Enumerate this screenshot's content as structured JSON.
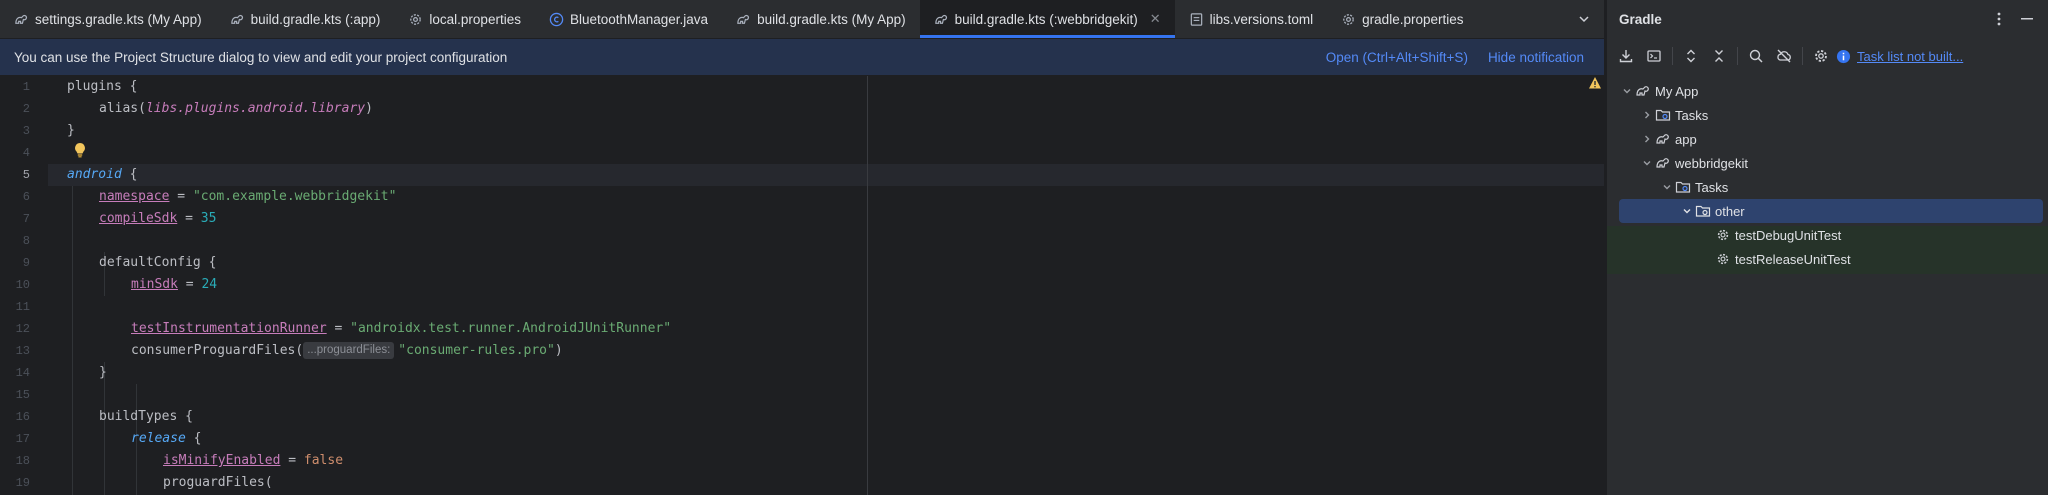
{
  "tabs": [
    {
      "label": "settings.gradle.kts (My App)",
      "icon": "gradle-icon",
      "active": false
    },
    {
      "label": "build.gradle.kts (:app)",
      "icon": "gradle-icon",
      "active": false
    },
    {
      "label": "local.properties",
      "icon": "settings-file-icon",
      "active": false
    },
    {
      "label": "BluetoothManager.java",
      "icon": "java-class-icon",
      "active": false
    },
    {
      "label": "build.gradle.kts (My App)",
      "icon": "gradle-icon",
      "active": false
    },
    {
      "label": "build.gradle.kts (:webbridgekit)",
      "icon": "gradle-icon",
      "active": true
    },
    {
      "label": "libs.versions.toml",
      "icon": "toml-icon",
      "active": false
    },
    {
      "label": "gradle.properties",
      "icon": "settings-file-icon",
      "active": false
    }
  ],
  "notification": {
    "text": "You can use the Project Structure dialog to view and edit your project configuration",
    "open_link": "Open (Ctrl+Alt+Shift+S)",
    "hide_link": "Hide notification"
  },
  "editor": {
    "current_line": 5,
    "line_numbers": [
      "1",
      "2",
      "3",
      "4",
      "5",
      "6",
      "7",
      "8",
      "9",
      "10",
      "11",
      "12",
      "13",
      "14",
      "15",
      "16",
      "17",
      "18",
      "19"
    ],
    "code": {
      "l1_plugins": "plugins {",
      "l2_alias": "alias(",
      "l2_arg": "libs.plugins.android.library",
      "l2_close": ")",
      "l3": "}",
      "l5_android": "android",
      "l5_brace": " {",
      "l6_prop": "namespace",
      "l6_eq": " = ",
      "l6_val": "\"com.example.webbridgekit\"",
      "l7_prop": "compileSdk",
      "l7_eq": " = ",
      "l7_val": "35",
      "l9": "defaultConfig {",
      "l10_prop": "minSdk",
      "l10_eq": " = ",
      "l10_val": "24",
      "l12_prop": "testInstrumentationRunner",
      "l12_eq": " = ",
      "l12_val": "\"androidx.test.runner.AndroidJUnitRunner\"",
      "l13_fn": "consumerProguardFiles(",
      "l13_hint": "...proguardFiles:",
      "l13_val": "\"consumer-rules.pro\"",
      "l13_close": ")",
      "l14": "}",
      "l16": "buildTypes {",
      "l17_release": "release",
      "l17_brace": " {",
      "l18_prop": "isMinifyEnabled",
      "l18_eq": " = ",
      "l18_val": "false",
      "l19": "proguardFiles("
    }
  },
  "gradle": {
    "title": "Gradle",
    "task_link": "Task list not built...",
    "tree": [
      {
        "label": "My App",
        "depth": 0,
        "expanded": true,
        "icon": "gradle-project-icon"
      },
      {
        "label": "Tasks",
        "depth": 1,
        "expanded": false,
        "icon": "task-folder-icon"
      },
      {
        "label": "app",
        "depth": 1,
        "expanded": false,
        "icon": "gradle-module-icon"
      },
      {
        "label": "webbridgekit",
        "depth": 1,
        "expanded": true,
        "icon": "gradle-module-icon"
      },
      {
        "label": "Tasks",
        "depth": 2,
        "expanded": true,
        "icon": "task-folder-icon"
      },
      {
        "label": "other",
        "depth": 3,
        "expanded": true,
        "icon": "task-folder-icon",
        "selected": true
      },
      {
        "label": "testDebugUnitTest",
        "depth": 4,
        "icon": "gear-icon"
      },
      {
        "label": "testReleaseUnitTest",
        "depth": 4,
        "icon": "gear-icon"
      }
    ]
  },
  "colors": {
    "accent": "#3574f0",
    "link": "#548af7",
    "selection": "#2e436e",
    "notification_bg": "#25324d"
  }
}
